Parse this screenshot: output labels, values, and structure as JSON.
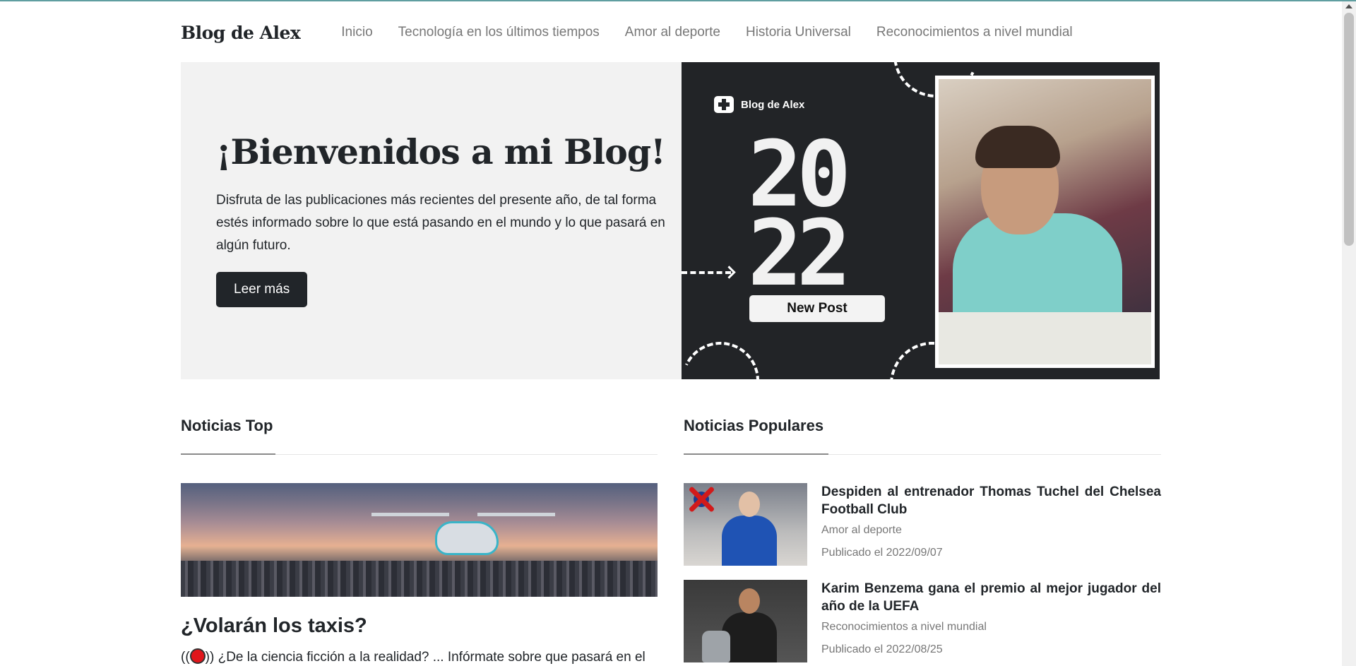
{
  "header": {
    "brand": "Blog de Alex",
    "nav": [
      "Inicio",
      "Tecnología en los últimos tiempos",
      "Amor al deporte",
      "Historia Universal",
      "Reconocimientos a nivel mundial"
    ]
  },
  "hero": {
    "title": "¡Bienvenidos a mi Blog!",
    "text": "Disfruta de las publicaciones más recientes del presente año, de tal forma estés informado sobre lo que está pasando en el mundo y lo que pasará en algún futuro.",
    "button": "Leer más",
    "banner": {
      "logo_text": "Blog de Alex",
      "year_top": "20",
      "year_bottom": "22",
      "tag": "New Post"
    }
  },
  "top_news": {
    "heading": "Noticias Top",
    "headline": "¿Volarán los taxis?",
    "excerpt_prefix": "((",
    "excerpt_suffix": ")) ¿De la ciencia ficción a la realidad? ... Infórmate sobre que pasará en el"
  },
  "popular_news": {
    "heading": "Noticias Populares",
    "items": [
      {
        "title": "Despiden al entrenador Thomas Tuchel del Chelsea Football Club",
        "category": "Amor al deporte",
        "date": "Publicado el 2022/09/07"
      },
      {
        "title": "Karim Benzema gana el premio al mejor jugador del año de la UEFA",
        "category": "Reconocimientos a nivel mundial",
        "date": "Publicado el 2022/08/25"
      }
    ]
  },
  "colors": {
    "dark": "#212529",
    "muted": "#777777",
    "hero_bg": "#f2f2f2",
    "banner_bg": "#222427",
    "accent_red": "#e0161b"
  }
}
